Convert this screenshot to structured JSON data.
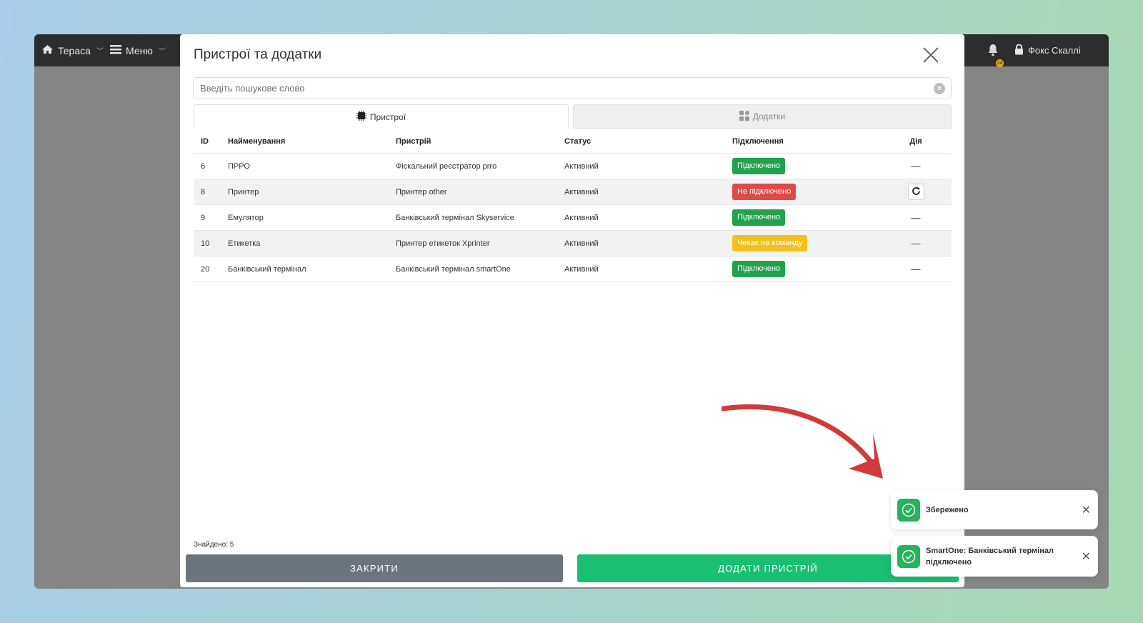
{
  "topbar": {
    "location": "Тераса",
    "menu": "Меню",
    "notifications_count": "24",
    "user": "Фокс Скаллі"
  },
  "modal": {
    "title": "Пристрої та додатки",
    "search_placeholder": "Введіть пошукове слово",
    "tabs": [
      {
        "label": "Пристрої",
        "icon": "chip-icon",
        "active": true
      },
      {
        "label": "Додатки",
        "icon": "grid-icon",
        "active": false
      }
    ],
    "columns": [
      "ID",
      "Найменування",
      "Пристрій",
      "Статус",
      "Підключення",
      "Дія"
    ],
    "rows": [
      {
        "id": "6",
        "name": "ПРРО",
        "device": "Фіскальний реєстратор prro",
        "status": "Активний",
        "connection": "Підключено",
        "connection_color": "#23a24d",
        "action": "—"
      },
      {
        "id": "8",
        "name": "Принтер",
        "device": "Принтер other",
        "status": "Активний",
        "connection": "Не підключено",
        "connection_color": "#dc4b48",
        "action": "refresh"
      },
      {
        "id": "9",
        "name": "Емулятор",
        "device": "Банківський термінал Skyservice",
        "status": "Активний",
        "connection": "Підключено",
        "connection_color": "#23a24d",
        "action": "—"
      },
      {
        "id": "10",
        "name": "Етикетка",
        "device": "Принтер етикеток Xprinter",
        "status": "Активний",
        "connection": "Чекає на команду",
        "connection_color": "#f1c21b",
        "action": "—"
      },
      {
        "id": "20",
        "name": "Банківський термінал",
        "device": "Банківський термінал smartOne",
        "status": "Активний",
        "connection": "Підключено",
        "connection_color": "#23a24d",
        "action": "—"
      }
    ],
    "found": "Знайдено: 5",
    "close_button": "ЗАКРИТИ",
    "add_button": "ДОДАТИ ПРИСТРІЙ"
  },
  "toasts": [
    {
      "text": "Збережено"
    },
    {
      "text": "SmartOne: Банківський термінал підключено"
    }
  ],
  "colors": {
    "success": "#1abf73",
    "secondary": "#6c757d",
    "danger": "#dc4b48",
    "warning": "#f1c21b",
    "annotation_arrow": "#d13a3a"
  }
}
